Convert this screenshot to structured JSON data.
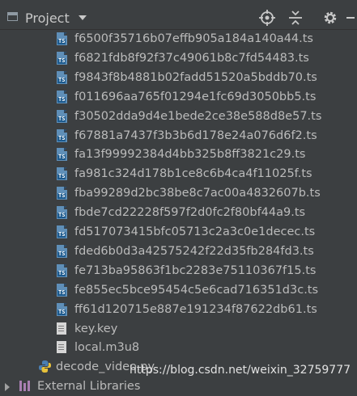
{
  "header": {
    "title": "Project"
  },
  "files": [
    "f6500f35716b07effb905a184a140a44.ts",
    "f6821fdb8f92f37c49061b8c7fd54483.ts",
    "f9843f8b4881b02fadd51520a5bddb70.ts",
    "f011696aa765f01294e1fc69d3050bb5.ts",
    "f30502dda9d4e1bede2ce38e588d8e57.ts",
    "f67881a7437f3b3b6d178e24a076d6f2.ts",
    "fa13f99992384d4bb325b8ff3821c29.ts",
    "fa981c324d178b1ce8c6b4ca4f11025f.ts",
    "fba99289d2bc38be8c7ac00a4832607b.ts",
    "fbde7cd22228f597f2d0fc2f80bf44a9.ts",
    "fd517073415bfc05713c2a3c0e1decec.ts",
    "fded6b0d3a42575242f22d35fb284fd3.ts",
    "fe713ba95863f1bc2283e75110367f15.ts",
    "fe855ec5bce95454c5e6cad716351d3c.ts",
    "ff61d120715e887e191234f87622db61.ts"
  ],
  "other_files": {
    "key": "key.key",
    "m3u8": "local.m3u8",
    "script": "decode_video.py",
    "libs": "External Libraries"
  },
  "watermark": {
    "url": "https://blog.csdn.net/weixin_32759777"
  },
  "colors": {
    "background": "#3c3f41",
    "text": "#bbbbbb",
    "ts_icon": "#5f8fb8"
  }
}
